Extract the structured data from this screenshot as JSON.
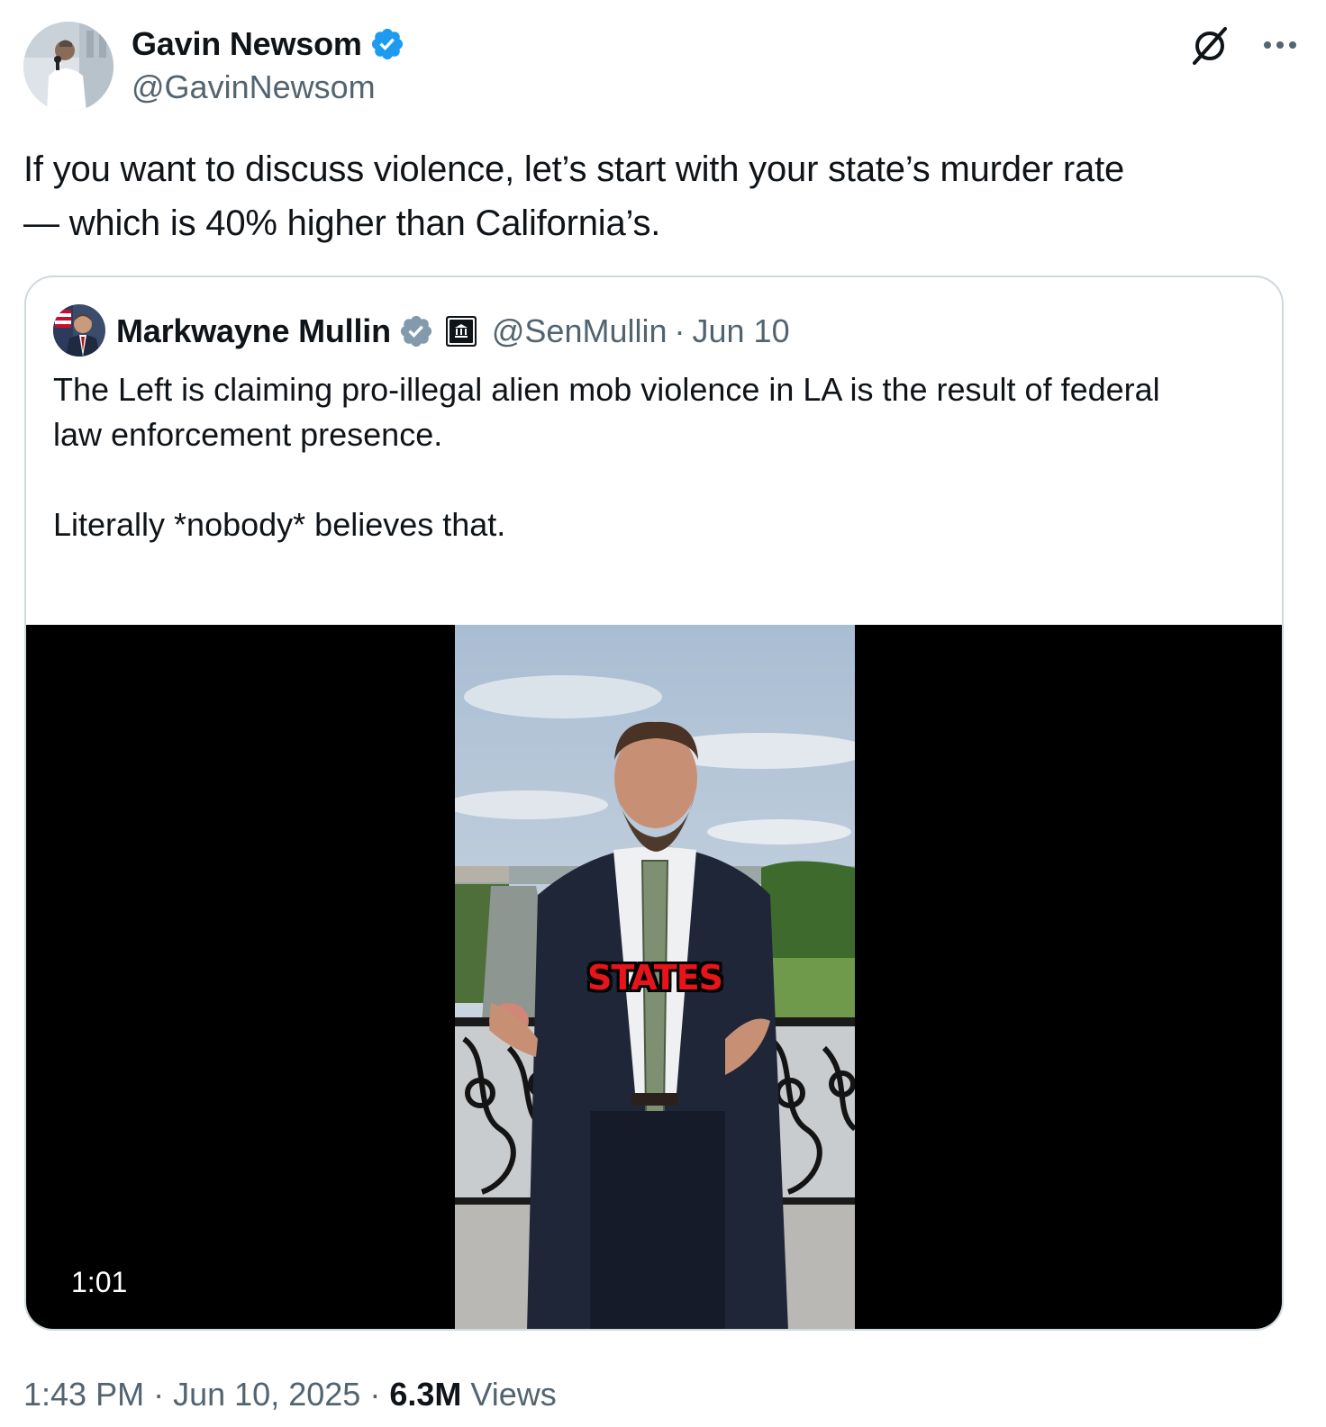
{
  "tweet": {
    "author": {
      "display_name": "Gavin Newsom",
      "handle": "@GavinNewsom",
      "verified": true
    },
    "text_line1": "If you want to discuss violence, let’s start with your state’s murder rate",
    "text_line2": "— which is 40% higher than California’s.",
    "timestamp_time": "1:43 PM",
    "timestamp_date": "Jun 10, 2025",
    "separator": "·",
    "views_count": "6.3M",
    "views_label": "Views"
  },
  "quoted": {
    "author": {
      "display_name": "Markwayne Mullin",
      "handle": "@SenMullin",
      "verified": true,
      "affiliation": "government-building-icon"
    },
    "separator": "·",
    "date": "Jun 10",
    "text_line1": "The Left is claiming pro-illegal alien mob violence in LA is the result of federal",
    "text_line2": "law enforcement presence.",
    "text_line3": "Literally *nobody* believes that.",
    "ellipsis": "...",
    "video": {
      "caption": "STATES",
      "duration": "1:01"
    }
  },
  "icons": {
    "grok": "grok-icon",
    "more": "more-icon"
  },
  "colors": {
    "verified_blue": "#1d9bf0",
    "verified_gray": "#829aab",
    "text_primary": "#0f1419",
    "text_secondary": "#536471",
    "border": "#cfd9de",
    "caption_red": "#e8141b"
  }
}
